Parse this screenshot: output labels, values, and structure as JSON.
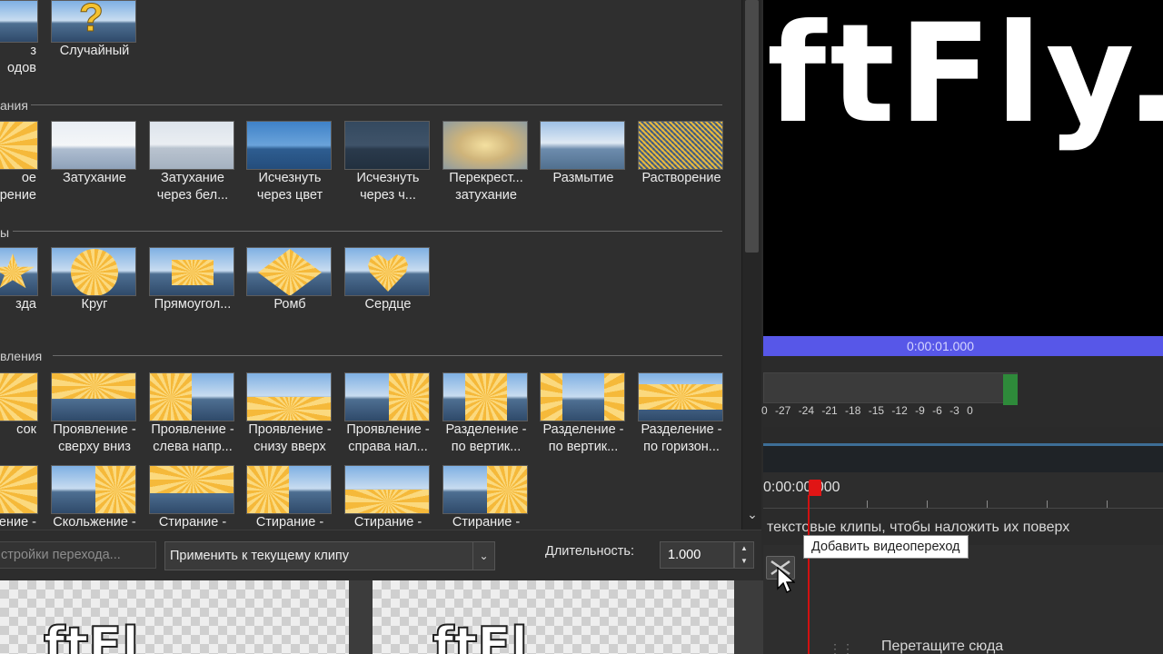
{
  "transitions_panel": {
    "sections": [
      {
        "label": "ания"
      },
      {
        "label": "ы"
      },
      {
        "label": "вления"
      }
    ],
    "top_row": [
      {
        "label": "з\nодов",
        "icon": "transition-random-set-thumb"
      },
      {
        "label": "Случайный",
        "icon": "question-mark-icon"
      }
    ],
    "fade_row": [
      {
        "label": "ое\nрение"
      },
      {
        "label": "Затухание"
      },
      {
        "label": "Затухание\nчерез бел..."
      },
      {
        "label": "Исчезнуть\nчерез цвет"
      },
      {
        "label": "Исчезнуть\nчерез ч..."
      },
      {
        "label": "Перекрест...\nзатухание"
      },
      {
        "label": "Размытие"
      },
      {
        "label": "Растворение"
      }
    ],
    "shape_row": [
      {
        "label": "зда"
      },
      {
        "label": "Круг"
      },
      {
        "label": "Прямоугол..."
      },
      {
        "label": "Ромб"
      },
      {
        "label": "Сердце"
      }
    ],
    "reveal_row": [
      {
        "label": "сок"
      },
      {
        "label": "Проявление -\nсверху вниз"
      },
      {
        "label": "Проявление -\nслева напр..."
      },
      {
        "label": "Проявление -\nснизу вверх"
      },
      {
        "label": "Проявление -\nсправа нал..."
      },
      {
        "label": "Разделение -\nпо вертик..."
      },
      {
        "label": "Разделение -\nпо вертик..."
      },
      {
        "label": "Разделение -\nпо горизон..."
      }
    ],
    "slide_row": [
      {
        "label": "ение -"
      },
      {
        "label": "Скольжение -"
      },
      {
        "label": "Стирание -"
      },
      {
        "label": "Стирание -"
      },
      {
        "label": "Стирание -"
      },
      {
        "label": "Стирание -"
      }
    ]
  },
  "toolbar": {
    "settings_label": "стройки перехода...",
    "apply_select_value": "Применить к текущему клипу",
    "duration_label": "Длительность:",
    "duration_value": "1.000"
  },
  "preview": {
    "logo_text": "ftFly.r",
    "bottom_thumb_text_1": "ftFl",
    "bottom_thumb_text_2": "ftFl"
  },
  "timeline": {
    "clip_time": "0:00:01.000",
    "ruler_time": "0:00:00.000",
    "meter_scale": "0 -27 -24 -21 -18 -15 -12 -9 -6 -3 0",
    "hint_text": "текстовые клипы, чтобы наложить их поверх",
    "drop_text": "Перетащите сюда",
    "tooltip": "Добавить видеопереход"
  }
}
